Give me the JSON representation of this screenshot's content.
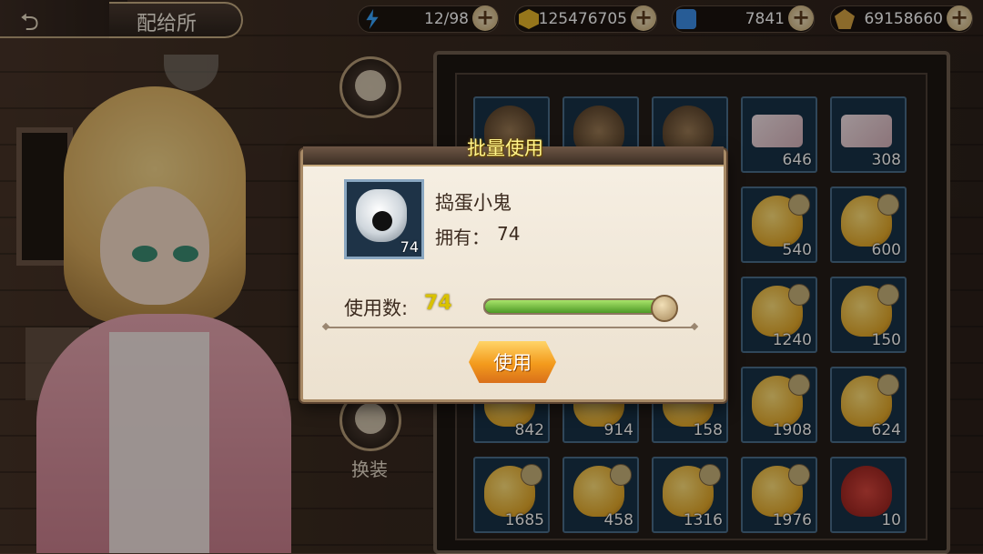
{
  "header": {
    "title": "配给所",
    "resources": [
      {
        "icon": "energy-icon",
        "value": "12/98",
        "color": "#3aa7ff"
      },
      {
        "icon": "gold-coin-icon",
        "value": "125476705",
        "color": "#e7b62a"
      },
      {
        "icon": "blue-ticket-icon",
        "value": "7841",
        "color": "#3d8ee6"
      },
      {
        "icon": "gem-icon",
        "value": "69158660",
        "color": "#d6a342"
      }
    ],
    "plus": "+"
  },
  "side": {
    "costume_label": "换装"
  },
  "inventory": {
    "rows": [
      [
        {
          "type": "misc",
          "count": ""
        },
        {
          "type": "misc",
          "count": ""
        },
        {
          "type": "misc",
          "count": ""
        },
        {
          "type": "card",
          "count": "646"
        },
        {
          "type": "card",
          "count": "308"
        }
      ],
      [
        {
          "type": "gold",
          "count": ""
        },
        {
          "type": "gold",
          "count": ""
        },
        {
          "type": "gold",
          "count": ""
        },
        {
          "type": "gold",
          "count": "540"
        },
        {
          "type": "gold",
          "count": "600"
        }
      ],
      [
        {
          "type": "gold",
          "count": ""
        },
        {
          "type": "gold",
          "count": ""
        },
        {
          "type": "gold",
          "count": ""
        },
        {
          "type": "gold",
          "count": "1240"
        },
        {
          "type": "gold",
          "count": "150"
        }
      ],
      [
        {
          "type": "gold",
          "count": "842"
        },
        {
          "type": "gold",
          "count": "914"
        },
        {
          "type": "gold",
          "count": "158"
        },
        {
          "type": "gold",
          "count": "1908"
        },
        {
          "type": "gold",
          "count": "624"
        }
      ],
      [
        {
          "type": "gold",
          "count": "1685"
        },
        {
          "type": "gold",
          "count": "458"
        },
        {
          "type": "gold",
          "count": "1316"
        },
        {
          "type": "gold",
          "count": "1976"
        },
        {
          "type": "red",
          "count": "10"
        }
      ]
    ]
  },
  "dialog": {
    "title": "批量使用",
    "item_name": "捣蛋小鬼",
    "item_count": "74",
    "own_label": "拥有：",
    "own_value": "74",
    "use_label": "使用数:",
    "use_value": "74",
    "slider_fraction": 1.0,
    "use_button": "使用"
  },
  "colors": {
    "accent": "#f39a1c",
    "use_value": "#d9c200",
    "slider_green": "#4d9a26"
  }
}
